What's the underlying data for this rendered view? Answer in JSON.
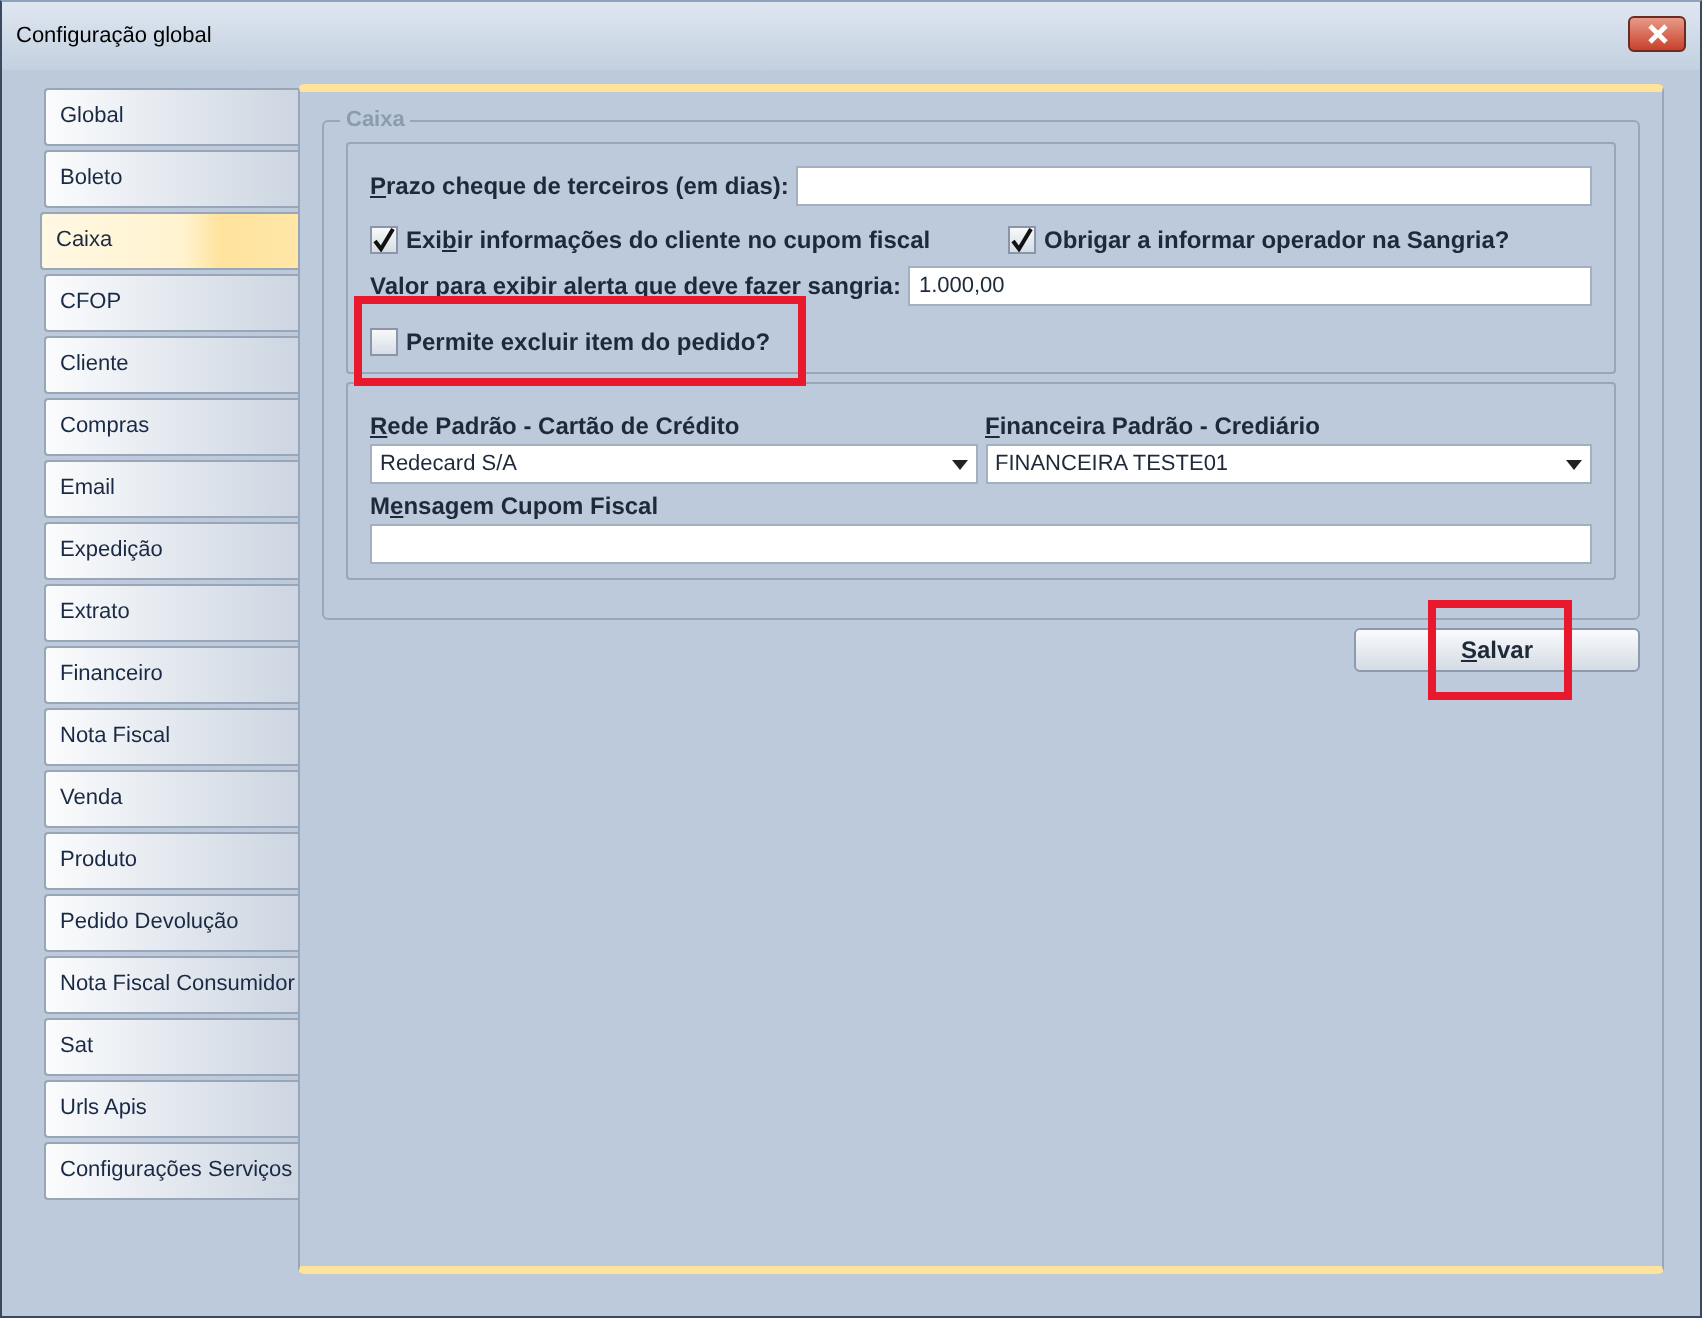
{
  "window": {
    "title": "Configuração global"
  },
  "tabs": [
    {
      "label": "Global",
      "selected": false
    },
    {
      "label": "Boleto",
      "selected": false
    },
    {
      "label": "Caixa",
      "selected": true
    },
    {
      "label": "CFOP",
      "selected": false
    },
    {
      "label": "Cliente",
      "selected": false
    },
    {
      "label": "Compras",
      "selected": false
    },
    {
      "label": "Email",
      "selected": false
    },
    {
      "label": "Expedição",
      "selected": false
    },
    {
      "label": "Extrato",
      "selected": false
    },
    {
      "label": "Financeiro",
      "selected": false
    },
    {
      "label": "Nota Fiscal",
      "selected": false
    },
    {
      "label": "Venda",
      "selected": false
    },
    {
      "label": "Produto",
      "selected": false
    },
    {
      "label": "Pedido Devolução",
      "selected": false
    },
    {
      "label": "Nota Fiscal Consumidor",
      "selected": false
    },
    {
      "label": "Sat",
      "selected": false
    },
    {
      "label": "Urls Apis",
      "selected": false
    },
    {
      "label": "Configurações Serviços",
      "selected": false
    }
  ],
  "caixa": {
    "legend": "Caixa",
    "fields": [
      {
        "kind": "input",
        "label": {
          "key": "P",
          "after": "razo cheque de terceiros (em dias):"
        }
      },
      {
        "kind": "checkbox_pair",
        "items": [
          {
            "label": {
              "before": "Exi",
              "key": "b",
              "after": "ir informações do cliente no cupom fiscal"
            },
            "checked": true
          },
          {
            "label": {
              "before": "Obrigar a informar operador na Sangria?"
            },
            "checked": true
          }
        ]
      },
      {
        "kind": "input",
        "label": {
          "before": "Valor para exibir alerta que deve fazer sangria:"
        },
        "value": "1.000,00"
      },
      {
        "kind": "checkbox",
        "label": {
          "before": "Permite excluir item do pedido?"
        },
        "checked": false,
        "highlighted": true
      }
    ],
    "selects": [
      {
        "label": {
          "key": "R",
          "after": "ede Padrão - Cartão de Crédito"
        },
        "value": "Redecard S/A"
      },
      {
        "label": {
          "key": "F",
          "after": "inanceira Padrão - Crediário"
        },
        "value": "FINANCEIRA TESTE01"
      }
    ],
    "message": {
      "label": {
        "before": "M",
        "key": "e",
        "after": "nsagem Cupom Fiscal"
      }
    }
  },
  "save_button": {
    "label": {
      "key": "S",
      "after": "alvar"
    },
    "highlighted": true
  }
}
